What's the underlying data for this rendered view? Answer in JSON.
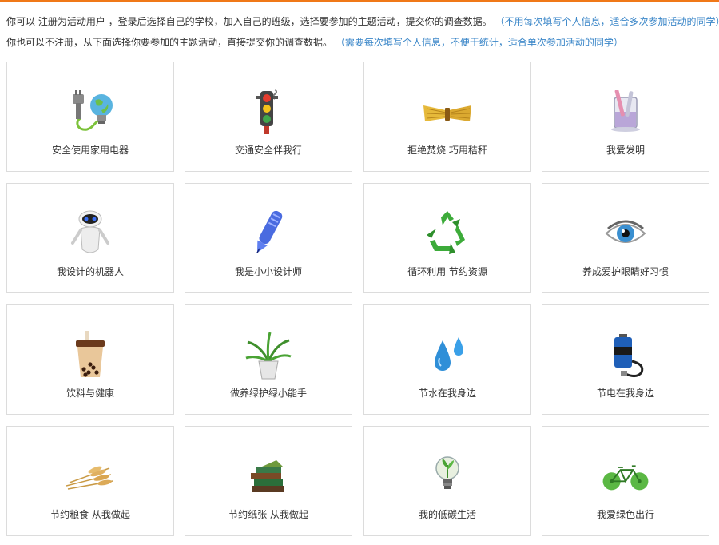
{
  "intro": {
    "line1_text": "你可以 注册为活动用户 ，登录后选择自己的学校，加入自己的班级，选择要参加的主题活动，提交你的调查数据。",
    "line1_note": "（不用每次填写个人信息，适合多次参加活动的同学）",
    "line2_text": "你也可以不注册，从下面选择你要参加的主题活动，直接提交你的调查数据。",
    "line2_note": "（需要每次填写个人信息，不便于统计，适合单次参加活动的同学）"
  },
  "colors": {
    "top_bar": "#f07818",
    "note_text": "#3a86c8",
    "card_border": "#dcdcdc"
  },
  "activities": [
    {
      "label": "安全使用家用电器",
      "icon": "plug-bulb-icon"
    },
    {
      "label": "交通安全伴我行",
      "icon": "traffic-light-icon"
    },
    {
      "label": "拒绝焚烧 巧用秸秆",
      "icon": "straw-bundle-icon"
    },
    {
      "label": "我爱发明",
      "icon": "beaker-icon"
    },
    {
      "label": "我设计的机器人",
      "icon": "robot-icon"
    },
    {
      "label": "我是小小设计师",
      "icon": "pen-icon"
    },
    {
      "label": "循环利用 节约资源",
      "icon": "recycle-icon"
    },
    {
      "label": "养成爱护眼睛好习惯",
      "icon": "eye-icon"
    },
    {
      "label": "饮料与健康",
      "icon": "bubble-tea-icon"
    },
    {
      "label": "做养绿护绿小能手",
      "icon": "potted-plant-icon"
    },
    {
      "label": "节水在我身边",
      "icon": "water-drop-icon"
    },
    {
      "label": "节电在我身边",
      "icon": "battery-icon"
    },
    {
      "label": "节约粮食 从我做起",
      "icon": "wheat-icon"
    },
    {
      "label": "节约纸张 从我做起",
      "icon": "books-icon"
    },
    {
      "label": "我的低碳生活",
      "icon": "eco-bulb-icon"
    },
    {
      "label": "我爱绿色出行",
      "icon": "green-bicycle-icon"
    }
  ]
}
